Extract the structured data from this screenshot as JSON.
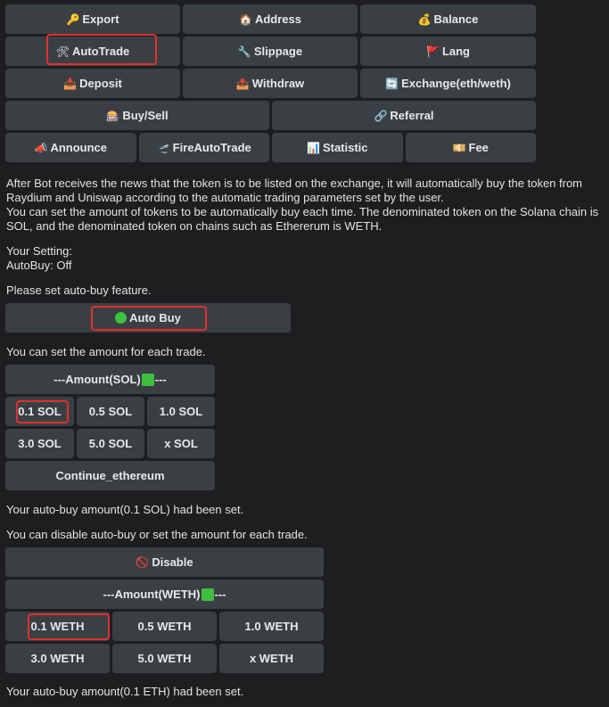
{
  "menu": {
    "row1": [
      {
        "icon": "🔑",
        "label": "Export"
      },
      {
        "icon": "🏠",
        "label": "Address"
      },
      {
        "icon": "💰",
        "label": "Balance"
      }
    ],
    "row2": [
      {
        "icon": "🛠",
        "label": "AutoTrade"
      },
      {
        "icon": "🔧",
        "label": "Slippage"
      },
      {
        "icon": "🚩",
        "label": "Lang"
      }
    ],
    "row3": [
      {
        "icon": "📥",
        "label": "Deposit"
      },
      {
        "icon": "📤",
        "label": "Withdraw"
      },
      {
        "icon": "🔄",
        "label": "Exchange(eth/weth)"
      }
    ],
    "row4": [
      {
        "icon": "🎰",
        "label": "Buy/Sell"
      },
      {
        "icon": "🔗",
        "label": "Referral"
      }
    ],
    "row5": [
      {
        "icon": "📣",
        "label": "Announce"
      },
      {
        "icon": "🛫",
        "label": "FireAutoTrade"
      },
      {
        "icon": "📊",
        "label": "Statistic"
      },
      {
        "icon": "💴",
        "label": "Fee"
      }
    ]
  },
  "intro": {
    "p1": "After Bot receives the news that the token is to be listed on the exchange, it will automatically buy the token from Raydium and Uniswap according to the automatic trading parameters set by the user.",
    "p2": "You can set the amount of tokens to be automatically buy each time. The denominated token on the Solana chain is SOL, and the denominated token on chains such as Ethererum is WETH."
  },
  "setting": {
    "line1": "Your Setting:",
    "line2": "AutoBuy: Off"
  },
  "prompt_autobuy": "Please set auto-buy feature.",
  "autobuy_button": "Auto Buy",
  "prompt_amount": "You can set the amount for each trade.",
  "sol": {
    "header_prefix": "---Amount(SOL)",
    "header_suffix": "---",
    "row1": [
      "0.1 SOL",
      "0.5 SOL",
      "1.0 SOL"
    ],
    "row2": [
      "3.0 SOL",
      "5.0 SOL",
      "x SOL"
    ],
    "continue": "Continue_ethereum"
  },
  "sol_set_msg": "Your auto-buy amount(0.1 SOL) had been set.",
  "prompt_disable": "You can disable auto-buy or set the amount for each trade.",
  "weth": {
    "disable_icon": "🚫",
    "disable": "Disable",
    "header_prefix": "---Amount(WETH)",
    "header_suffix": "---",
    "row1": [
      "0.1 WETH",
      "0.5 WETH",
      "1.0 WETH"
    ],
    "row2": [
      "3.0 WETH",
      "5.0 WETH",
      "x WETH"
    ]
  },
  "eth_set_msg": "Your auto-buy amount(0.1 ETH) had been set.",
  "colors": {
    "highlight": "#e0302f",
    "button_bg": "#3a3f44",
    "background": "#1e1e20"
  }
}
